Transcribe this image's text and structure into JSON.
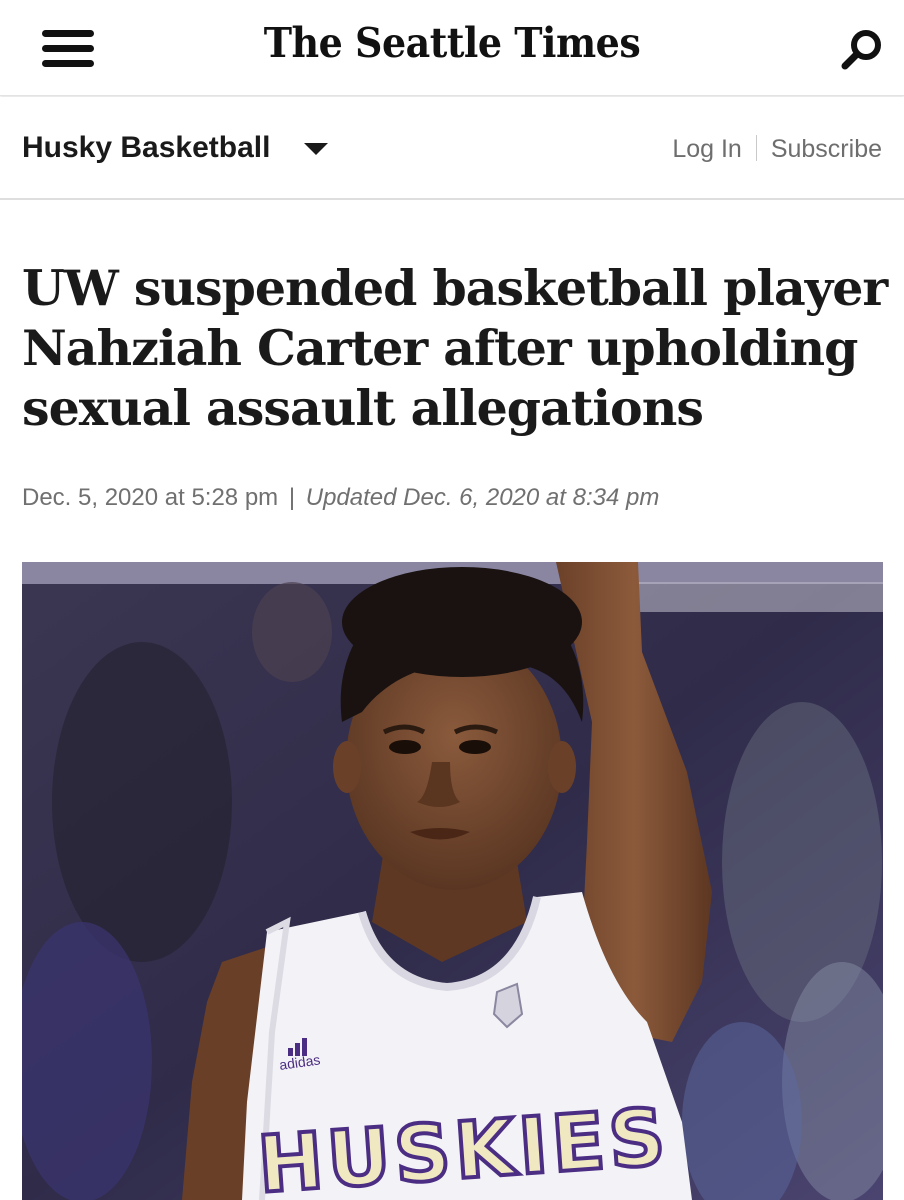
{
  "header": {
    "logo": "The Seattle Times",
    "menu_icon": "hamburger-menu-icon",
    "search_icon": "search-icon"
  },
  "section": {
    "title": "Husky Basketball",
    "login": "Log In",
    "subscribe": "Subscribe"
  },
  "article": {
    "headline": "UW suspended basketball player Nahziah Carter after upholding sexual assault allegations",
    "published": "Dec. 5, 2020 at 5:28 pm",
    "separator": "|",
    "updated": "Updated Dec. 6, 2020 at 8:34 pm"
  },
  "photo": {
    "jersey_text": "HUSKIES",
    "brand_text": "adidas"
  },
  "colors": {
    "text": "#1a1a1a",
    "muted": "#707070",
    "jersey_purple": "#4b2e83"
  }
}
